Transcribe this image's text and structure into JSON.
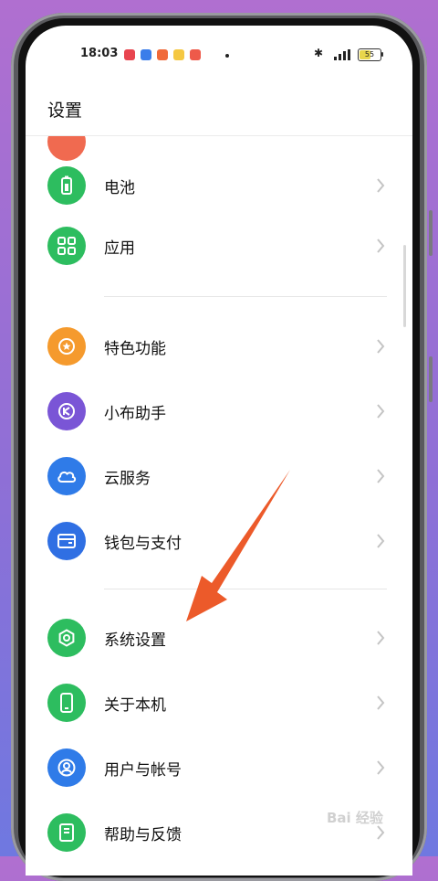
{
  "status": {
    "time": "18:03",
    "battery": "55",
    "battery_level": 0.55,
    "notification_colors": [
      "#e8454f",
      "#3b7dea",
      "#f06a3a",
      "#f5c842",
      "#ee5a4a"
    ]
  },
  "header": {
    "title": "设置"
  },
  "settings": [
    {
      "label": "电池",
      "icon": "battery-icon",
      "color": "#2dbd5f"
    },
    {
      "label": "应用",
      "icon": "apps-grid-icon",
      "color": "#2dbd5f"
    },
    {
      "label": "特色功能",
      "icon": "star-icon",
      "color": "#f59a2d"
    },
    {
      "label": "小布助手",
      "icon": "assistant-icon",
      "color": "#7a55d6"
    },
    {
      "label": "云服务",
      "icon": "cloud-icon",
      "color": "#2f7be8"
    },
    {
      "label": "钱包与支付",
      "icon": "wallet-icon",
      "color": "#2f6fe3"
    },
    {
      "label": "系统设置",
      "icon": "system-settings-icon",
      "color": "#2dbd5f"
    },
    {
      "label": "关于本机",
      "icon": "phone-icon",
      "color": "#2dbd5f"
    },
    {
      "label": "用户与帐号",
      "icon": "user-icon",
      "color": "#2f7be8"
    },
    {
      "label": "帮助与反馈",
      "icon": "help-book-icon",
      "color": "#2dbd5f"
    }
  ],
  "watermark": {
    "text": "Bai 经验"
  },
  "annotation": {
    "color": "#ec5a2a"
  }
}
